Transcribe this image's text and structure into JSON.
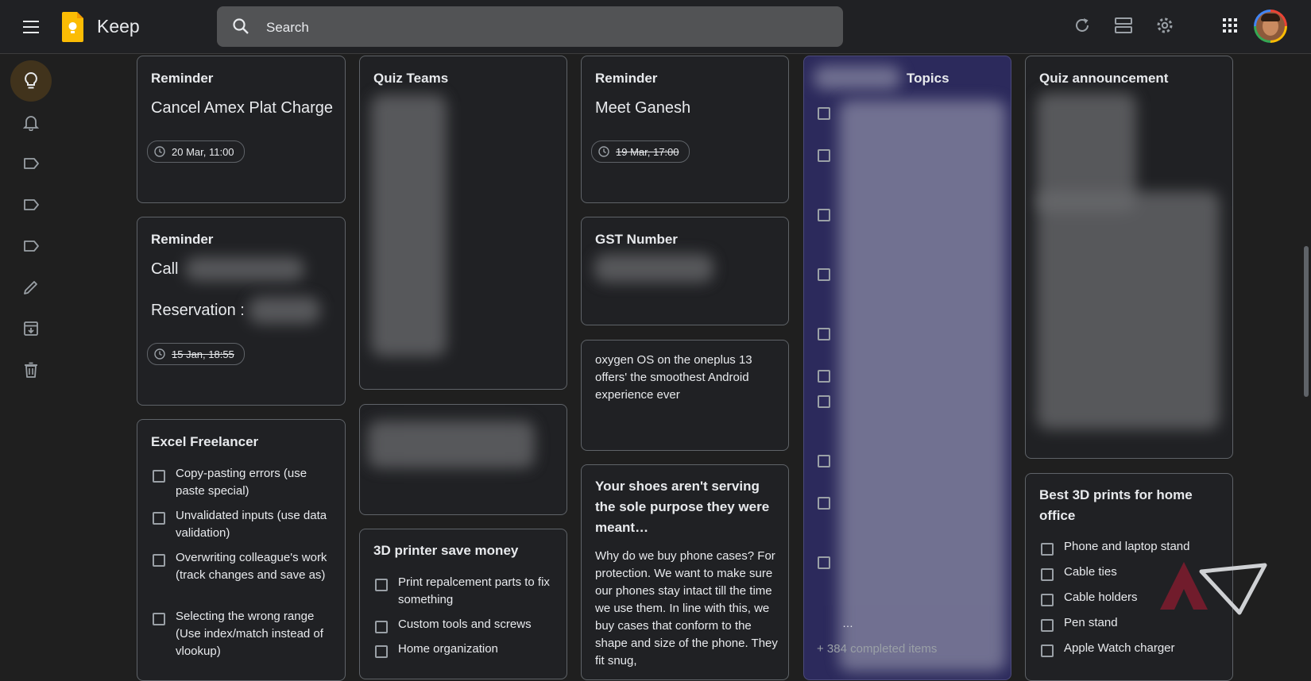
{
  "app": {
    "title": "Keep"
  },
  "search": {
    "placeholder": "Search"
  },
  "sidebar": {
    "items": [
      {
        "name": "notes",
        "icon": "lightbulb-icon"
      },
      {
        "name": "reminders",
        "icon": "bell-icon"
      },
      {
        "name": "label-1",
        "icon": "label-icon"
      },
      {
        "name": "label-2",
        "icon": "label-icon"
      },
      {
        "name": "label-3",
        "icon": "label-icon"
      },
      {
        "name": "edit-labels",
        "icon": "pencil-icon"
      },
      {
        "name": "archive",
        "icon": "archive-icon"
      },
      {
        "name": "trash",
        "icon": "trash-icon"
      }
    ]
  },
  "toolbar": {
    "icons": [
      "refresh-icon",
      "list-view-icon",
      "gear-icon",
      "apps-grid-icon"
    ]
  },
  "notes": {
    "reminder1": {
      "title": "Reminder",
      "body": "Cancel Amex Plat Charge",
      "chip": "20 Mar, 11:00"
    },
    "reminder2": {
      "title": "Reminder",
      "line1": "Call",
      "line2": "Reservation :",
      "chip": "15 Jan, 18:55"
    },
    "excel": {
      "title": "Excel Freelancer",
      "items": [
        "Copy-pasting errors (use paste special)",
        "Unvalidated inputs (use data validation)",
        "Overwriting colleague's work (track changes and save as)",
        "Selecting the wrong range (Use index/match instead of vlookup)"
      ]
    },
    "quiz_teams": {
      "title": "Quiz Teams"
    },
    "printer": {
      "title": "3D printer save money",
      "items": [
        "Print repalcement parts to fix something",
        "Custom tools and screws",
        "Home organization"
      ]
    },
    "reminder3": {
      "title": "Reminder",
      "body": "Meet Ganesh",
      "chip": "19 Mar, 17:00"
    },
    "gst": {
      "title": "GST Number"
    },
    "oxygen": {
      "body": "oxygen OS on the oneplus 13 offers' the smoothest Android experience ever"
    },
    "shoes": {
      "title": "Your shoes aren't serving the sole purpose they were meant…",
      "body": "Why do we buy phone cases? For protection. We want to make sure our phones stay intact till the time we use them. In line with this, we buy cases that conform to the shape and size of the phone. They fit snug,"
    },
    "topics": {
      "title": "Topics",
      "ellipsis": "…",
      "completed": "+ 384 completed items"
    },
    "quiz_announcement": {
      "title": "Quiz announcement"
    },
    "prints": {
      "title": "Best 3D prints for home office",
      "items": [
        "Phone and laptop stand",
        "Cable ties",
        "Cable holders",
        "Pen stand",
        "Apple Watch charger"
      ]
    }
  },
  "colors": {
    "accent": "#fbbc04",
    "topics_bg": "#2c2a5c",
    "active_nav": "#41331c"
  }
}
